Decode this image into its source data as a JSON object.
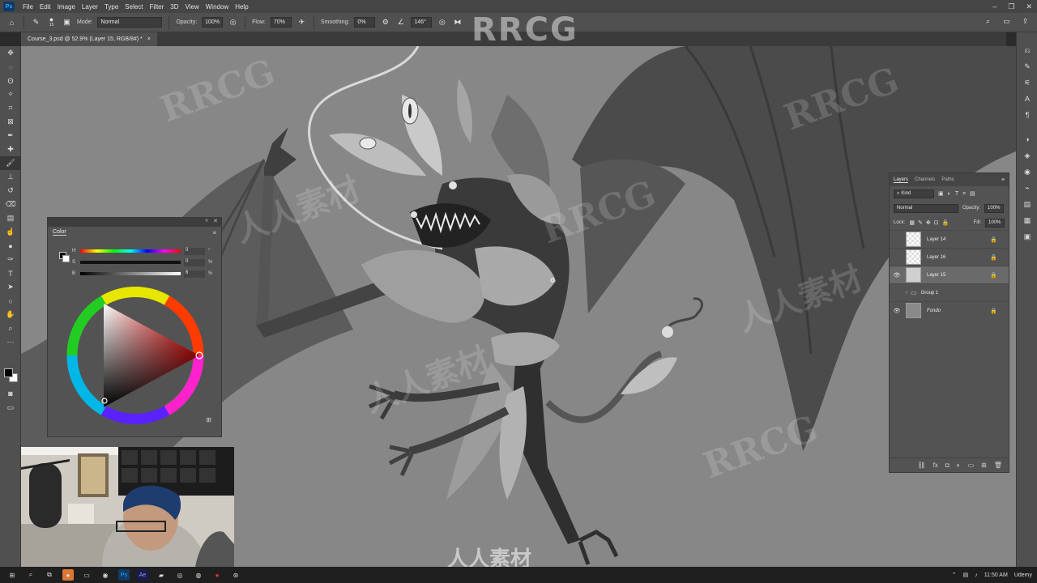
{
  "menubar": {
    "logo": "Ps",
    "items": [
      "File",
      "Edit",
      "Image",
      "Layer",
      "Type",
      "Select",
      "Filter",
      "3D",
      "View",
      "Window",
      "Help"
    ]
  },
  "options": {
    "brush_size": "15",
    "mode_label": "Mode:",
    "mode_value": "Normal",
    "opacity_label": "Opacity:",
    "opacity_value": "100%",
    "flow_label": "Flow:",
    "flow_value": "70%",
    "smoothing_label": "Smoothing:",
    "smoothing_value": "0%",
    "angle_value": "146°"
  },
  "document": {
    "tab_title": "Course_3.psd @ 52.9% (Layer 15, RGB/8#) *",
    "close_glyph": "×"
  },
  "color_panel": {
    "tab": "Color",
    "menu_glyph": "≡",
    "channels": [
      {
        "label": "H",
        "value": "0",
        "unit": "°"
      },
      {
        "label": "S",
        "value": "0",
        "unit": "%"
      },
      {
        "label": "B",
        "value": "6",
        "unit": "%"
      }
    ],
    "foreground_color": "#0f0f0f",
    "background_color": "#ffffff"
  },
  "layers_panel": {
    "tabs": [
      "Layers",
      "Channels",
      "Paths"
    ],
    "filter_value": "Kind",
    "blend_mode": "Normal",
    "opacity_label": "Opacity:",
    "opacity_value": "100%",
    "lock_label": "Lock:",
    "fill_label": "Fill:",
    "fill_value": "100%",
    "layers": [
      {
        "name": "Layer 14",
        "visible": false,
        "locked": true,
        "selected": false
      },
      {
        "name": "Layer 16",
        "visible": false,
        "locked": true,
        "selected": false
      },
      {
        "name": "Layer 15",
        "visible": true,
        "locked": true,
        "selected": true
      },
      {
        "name": "Group 1",
        "visible": false,
        "locked": false,
        "selected": false
      },
      {
        "name": "Fondo",
        "visible": true,
        "locked": true,
        "selected": false
      }
    ]
  },
  "watermarks": {
    "main": "RRCG",
    "secondary": "人人素材"
  },
  "taskbar": {
    "time": "11:50 AM",
    "udemy": "Udemy"
  }
}
